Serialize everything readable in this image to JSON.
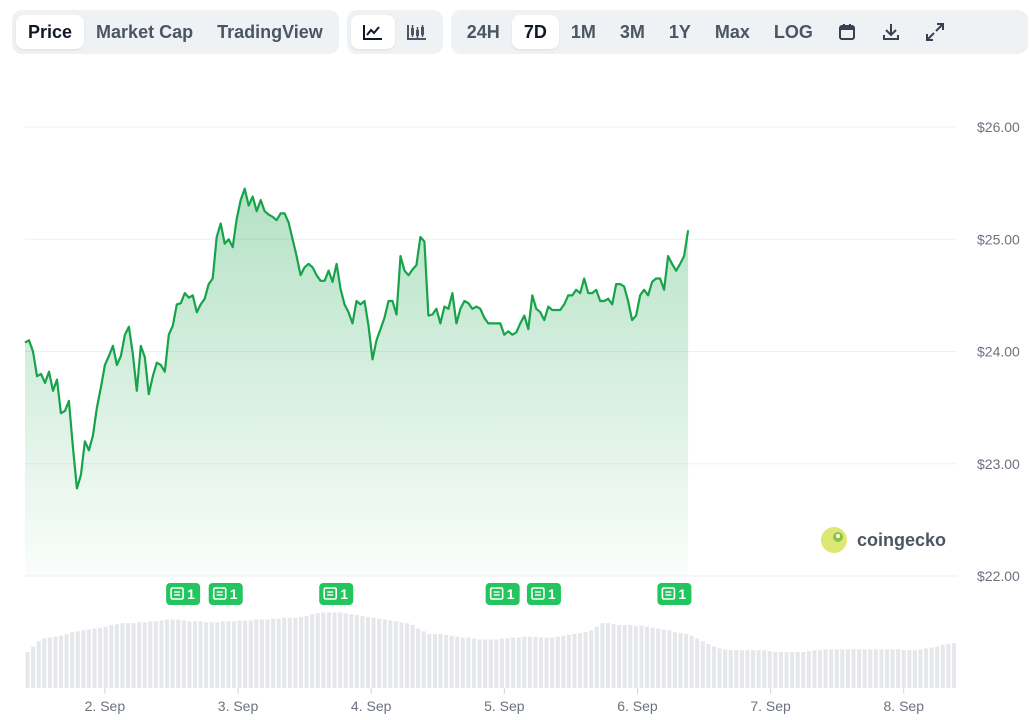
{
  "tabs": [
    {
      "label": "Price",
      "active": true
    },
    {
      "label": "Market Cap",
      "active": false
    },
    {
      "label": "TradingView",
      "active": false
    }
  ],
  "chart_types": [
    {
      "icon": "line-chart-icon",
      "active": true
    },
    {
      "icon": "candlestick-chart-icon",
      "active": false
    }
  ],
  "ranges": [
    {
      "label": "24H",
      "active": false
    },
    {
      "label": "7D",
      "active": true
    },
    {
      "label": "1M",
      "active": false
    },
    {
      "label": "3M",
      "active": false
    },
    {
      "label": "1Y",
      "active": false
    },
    {
      "label": "Max",
      "active": false
    },
    {
      "label": "LOG",
      "active": false
    }
  ],
  "tools": [
    {
      "icon": "calendar-icon"
    },
    {
      "icon": "download-icon"
    },
    {
      "icon": "expand-icon"
    }
  ],
  "watermark": "coingecko",
  "colors": {
    "line": "#16a34a",
    "news": "#22c55e",
    "volume": "#e5e7eb",
    "grid": "#eef0f2"
  },
  "chart_data": {
    "type": "area",
    "ylim": [
      22.0,
      26.0
    ],
    "yticks": [
      "$26.00",
      "$25.00",
      "$24.00",
      "$23.00",
      "$22.00"
    ],
    "ytick_values": [
      26,
      25,
      24,
      23,
      22
    ],
    "xticks": [
      "2. Sep",
      "3. Sep",
      "4. Sep",
      "5. Sep",
      "6. Sep",
      "7. Sep",
      "8. Sep"
    ],
    "xstart": 1.4,
    "xend": 8.4,
    "xtick_values": [
      2,
      3,
      4,
      5,
      6,
      7,
      8
    ],
    "price": [
      [
        1.4,
        24.08
      ],
      [
        1.43,
        24.1
      ],
      [
        1.46,
        24.0
      ],
      [
        1.49,
        23.78
      ],
      [
        1.52,
        23.8
      ],
      [
        1.55,
        23.72
      ],
      [
        1.58,
        23.82
      ],
      [
        1.61,
        23.65
      ],
      [
        1.64,
        23.75
      ],
      [
        1.67,
        23.45
      ],
      [
        1.7,
        23.47
      ],
      [
        1.73,
        23.56
      ],
      [
        1.76,
        23.15
      ],
      [
        1.79,
        22.78
      ],
      [
        1.82,
        22.9
      ],
      [
        1.85,
        23.2
      ],
      [
        1.88,
        23.12
      ],
      [
        1.91,
        23.25
      ],
      [
        1.94,
        23.5
      ],
      [
        1.97,
        23.68
      ],
      [
        2.0,
        23.88
      ],
      [
        2.03,
        23.96
      ],
      [
        2.06,
        24.05
      ],
      [
        2.09,
        23.88
      ],
      [
        2.12,
        23.96
      ],
      [
        2.15,
        24.15
      ],
      [
        2.18,
        24.22
      ],
      [
        2.21,
        23.98
      ],
      [
        2.24,
        23.65
      ],
      [
        2.27,
        24.05
      ],
      [
        2.3,
        23.95
      ],
      [
        2.33,
        23.62
      ],
      [
        2.36,
        23.78
      ],
      [
        2.39,
        23.9
      ],
      [
        2.42,
        23.88
      ],
      [
        2.45,
        23.82
      ],
      [
        2.48,
        24.15
      ],
      [
        2.51,
        24.23
      ],
      [
        2.54,
        24.42
      ],
      [
        2.57,
        24.43
      ],
      [
        2.6,
        24.52
      ],
      [
        2.63,
        24.48
      ],
      [
        2.66,
        24.5
      ],
      [
        2.69,
        24.35
      ],
      [
        2.72,
        24.42
      ],
      [
        2.75,
        24.47
      ],
      [
        2.78,
        24.6
      ],
      [
        2.81,
        24.65
      ],
      [
        2.84,
        25.02
      ],
      [
        2.87,
        25.14
      ],
      [
        2.9,
        24.96
      ],
      [
        2.93,
        25.0
      ],
      [
        2.96,
        24.93
      ],
      [
        2.99,
        25.18
      ],
      [
        3.02,
        25.35
      ],
      [
        3.05,
        25.45
      ],
      [
        3.08,
        25.3
      ],
      [
        3.11,
        25.38
      ],
      [
        3.14,
        25.25
      ],
      [
        3.17,
        25.35
      ],
      [
        3.2,
        25.25
      ],
      [
        3.23,
        25.22
      ],
      [
        3.26,
        25.2
      ],
      [
        3.29,
        25.17
      ],
      [
        3.32,
        25.23
      ],
      [
        3.35,
        25.23
      ],
      [
        3.38,
        25.15
      ],
      [
        3.41,
        25.0
      ],
      [
        3.44,
        24.85
      ],
      [
        3.47,
        24.68
      ],
      [
        3.5,
        24.75
      ],
      [
        3.53,
        24.78
      ],
      [
        3.56,
        24.75
      ],
      [
        3.59,
        24.68
      ],
      [
        3.62,
        24.63
      ],
      [
        3.65,
        24.63
      ],
      [
        3.68,
        24.72
      ],
      [
        3.71,
        24.62
      ],
      [
        3.74,
        24.78
      ],
      [
        3.77,
        24.56
      ],
      [
        3.8,
        24.42
      ],
      [
        3.83,
        24.35
      ],
      [
        3.86,
        24.25
      ],
      [
        3.89,
        24.45
      ],
      [
        3.92,
        24.42
      ],
      [
        3.95,
        24.45
      ],
      [
        3.98,
        24.23
      ],
      [
        4.01,
        23.93
      ],
      [
        4.04,
        24.1
      ],
      [
        4.07,
        24.2
      ],
      [
        4.1,
        24.3
      ],
      [
        4.13,
        24.45
      ],
      [
        4.16,
        24.45
      ],
      [
        4.19,
        24.33
      ],
      [
        4.22,
        24.85
      ],
      [
        4.25,
        24.72
      ],
      [
        4.28,
        24.68
      ],
      [
        4.31,
        24.73
      ],
      [
        4.34,
        24.77
      ],
      [
        4.37,
        25.02
      ],
      [
        4.4,
        24.98
      ],
      [
        4.43,
        24.32
      ],
      [
        4.46,
        24.33
      ],
      [
        4.49,
        24.38
      ],
      [
        4.52,
        24.25
      ],
      [
        4.55,
        24.4
      ],
      [
        4.58,
        24.38
      ],
      [
        4.61,
        24.52
      ],
      [
        4.64,
        24.25
      ],
      [
        4.67,
        24.38
      ],
      [
        4.7,
        24.45
      ],
      [
        4.73,
        24.43
      ],
      [
        4.76,
        24.38
      ],
      [
        4.79,
        24.4
      ],
      [
        4.82,
        24.38
      ],
      [
        4.85,
        24.3
      ],
      [
        4.88,
        24.25
      ],
      [
        4.91,
        24.25
      ],
      [
        4.94,
        24.25
      ],
      [
        4.97,
        24.25
      ],
      [
        5.0,
        24.15
      ],
      [
        5.03,
        24.18
      ],
      [
        5.06,
        24.15
      ],
      [
        5.09,
        24.17
      ],
      [
        5.12,
        24.25
      ],
      [
        5.15,
        24.32
      ],
      [
        5.18,
        24.2
      ],
      [
        5.21,
        24.5
      ],
      [
        5.24,
        24.38
      ],
      [
        5.27,
        24.35
      ],
      [
        5.3,
        24.28
      ],
      [
        5.33,
        24.4
      ],
      [
        5.36,
        24.37
      ],
      [
        5.39,
        24.37
      ],
      [
        5.42,
        24.37
      ],
      [
        5.45,
        24.42
      ],
      [
        5.48,
        24.5
      ],
      [
        5.51,
        24.5
      ],
      [
        5.54,
        24.55
      ],
      [
        5.57,
        24.52
      ],
      [
        5.6,
        24.65
      ],
      [
        5.63,
        24.52
      ],
      [
        5.66,
        24.52
      ],
      [
        5.69,
        24.55
      ],
      [
        5.72,
        24.45
      ],
      [
        5.75,
        24.45
      ],
      [
        5.78,
        24.47
      ],
      [
        5.81,
        24.42
      ],
      [
        5.84,
        24.6
      ],
      [
        5.87,
        24.6
      ],
      [
        5.9,
        24.58
      ],
      [
        5.93,
        24.45
      ],
      [
        5.96,
        24.28
      ],
      [
        5.99,
        24.32
      ],
      [
        6.02,
        24.5
      ],
      [
        6.05,
        24.55
      ],
      [
        6.08,
        24.5
      ],
      [
        6.11,
        24.62
      ],
      [
        6.14,
        24.65
      ],
      [
        6.17,
        24.65
      ],
      [
        6.2,
        24.55
      ],
      [
        6.23,
        24.85
      ],
      [
        6.26,
        24.78
      ],
      [
        6.29,
        24.72
      ],
      [
        6.32,
        24.78
      ],
      [
        6.35,
        24.85
      ],
      [
        6.38,
        25.08
      ]
    ],
    "volume": [
      0.4,
      0.46,
      0.52,
      0.55,
      0.56,
      0.57,
      0.58,
      0.6,
      0.62,
      0.63,
      0.64,
      0.65,
      0.66,
      0.67,
      0.68,
      0.7,
      0.71,
      0.72,
      0.72,
      0.72,
      0.73,
      0.73,
      0.74,
      0.74,
      0.75,
      0.76,
      0.76,
      0.76,
      0.75,
      0.74,
      0.74,
      0.74,
      0.73,
      0.73,
      0.73,
      0.74,
      0.74,
      0.74,
      0.75,
      0.75,
      0.75,
      0.76,
      0.76,
      0.76,
      0.77,
      0.77,
      0.78,
      0.78,
      0.78,
      0.79,
      0.8,
      0.82,
      0.83,
      0.84,
      0.84,
      0.84,
      0.84,
      0.83,
      0.82,
      0.81,
      0.8,
      0.79,
      0.78,
      0.77,
      0.76,
      0.75,
      0.74,
      0.73,
      0.72,
      0.7,
      0.66,
      0.63,
      0.6,
      0.6,
      0.6,
      0.59,
      0.58,
      0.57,
      0.56,
      0.56,
      0.55,
      0.54,
      0.54,
      0.54,
      0.54,
      0.55,
      0.55,
      0.56,
      0.56,
      0.57,
      0.57,
      0.57,
      0.56,
      0.56,
      0.56,
      0.57,
      0.58,
      0.59,
      0.6,
      0.61,
      0.62,
      0.64,
      0.68,
      0.72,
      0.72,
      0.71,
      0.7,
      0.7,
      0.7,
      0.69,
      0.69,
      0.68,
      0.67,
      0.66,
      0.65,
      0.64,
      0.62,
      0.61,
      0.6,
      0.58,
      0.55,
      0.52,
      0.49,
      0.46,
      0.44,
      0.43,
      0.42,
      0.42,
      0.42,
      0.42,
      0.42,
      0.42,
      0.42,
      0.41,
      0.4,
      0.4,
      0.4,
      0.4,
      0.4,
      0.4,
      0.41,
      0.42,
      0.42,
      0.43,
      0.43,
      0.43,
      0.43,
      0.43,
      0.43,
      0.43,
      0.43,
      0.43,
      0.43,
      0.43,
      0.43,
      0.43,
      0.43,
      0.42,
      0.42,
      0.42,
      0.43,
      0.44,
      0.45,
      0.46,
      0.48,
      0.49,
      0.5
    ],
    "news": [
      {
        "x": 2.58,
        "label": "1"
      },
      {
        "x": 2.9,
        "label": "1"
      },
      {
        "x": 3.73,
        "label": "1"
      },
      {
        "x": 4.98,
        "label": "1"
      },
      {
        "x": 5.29,
        "label": "1"
      },
      {
        "x": 6.27,
        "label": "1"
      }
    ]
  }
}
